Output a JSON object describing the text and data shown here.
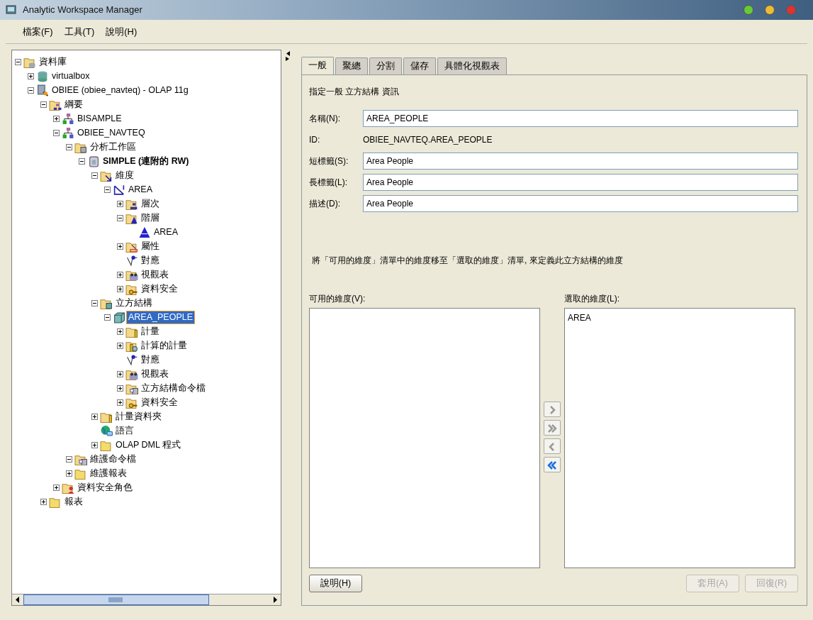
{
  "window": {
    "title": "Analytic Workspace Manager"
  },
  "menu": [
    {
      "label": "檔案(F)"
    },
    {
      "label": "工具(T)"
    },
    {
      "label": "說明(H)"
    }
  ],
  "tree": [
    {
      "label": "資料庫",
      "kind": "db-folder",
      "expanded": true,
      "selected": false,
      "children": [
        {
          "label": "virtualbox",
          "kind": "database",
          "expanded": false,
          "selected": false
        },
        {
          "label": "OBIEE (obiee_navteq) - OLAP 11g",
          "kind": "server",
          "expanded": true,
          "selected": false,
          "children": [
            {
              "label": "綱要",
              "kind": "schema-folder",
              "expanded": true,
              "selected": false,
              "children": [
                {
                  "label": "BISAMPLE",
                  "kind": "schema",
                  "expanded": false,
                  "selected": false
                },
                {
                  "label": "OBIEE_NAVTEQ",
                  "kind": "schema",
                  "expanded": true,
                  "selected": false,
                  "children": [
                    {
                      "label": "分析工作區",
                      "kind": "workspace-folder",
                      "expanded": true,
                      "selected": false,
                      "children": [
                        {
                          "label": "SIMPLE (連附的 RW)",
                          "kind": "workspace",
                          "expanded": true,
                          "selected": false,
                          "children": [
                            {
                              "label": "維度",
                              "kind": "dimension-folder",
                              "expanded": true,
                              "selected": false,
                              "children": [
                                {
                                  "label": "AREA",
                                  "kind": "dimension",
                                  "expanded": true,
                                  "selected": false,
                                  "children": [
                                    {
                                      "label": "層次",
                                      "kind": "level-folder",
                                      "expanded": false,
                                      "selected": false
                                    },
                                    {
                                      "label": "階層",
                                      "kind": "hierarchy-folder",
                                      "expanded": true,
                                      "selected": false,
                                      "children": [
                                        {
                                          "label": "AREA",
                                          "kind": "hierarchy",
                                          "selected": false
                                        }
                                      ]
                                    },
                                    {
                                      "label": "屬性",
                                      "kind": "attribute-folder",
                                      "expanded": false,
                                      "selected": false
                                    },
                                    {
                                      "label": "對應",
                                      "kind": "mapping",
                                      "selected": false
                                    },
                                    {
                                      "label": "視觀表",
                                      "kind": "view-folder",
                                      "expanded": false,
                                      "selected": false
                                    },
                                    {
                                      "label": "資料安全",
                                      "kind": "security-folder",
                                      "expanded": false,
                                      "selected": false
                                    }
                                  ]
                                }
                              ]
                            },
                            {
                              "label": "立方結構",
                              "kind": "cube-folder",
                              "expanded": true,
                              "selected": false,
                              "children": [
                                {
                                  "label": "AREA_PEOPLE",
                                  "kind": "cube",
                                  "expanded": true,
                                  "selected": true,
                                  "children": [
                                    {
                                      "label": "計量",
                                      "kind": "measure-folder",
                                      "expanded": false,
                                      "selected": false
                                    },
                                    {
                                      "label": "計算的計量",
                                      "kind": "calc-folder",
                                      "expanded": false,
                                      "selected": false
                                    },
                                    {
                                      "label": "對應",
                                      "kind": "mapping",
                                      "selected": false
                                    },
                                    {
                                      "label": "視觀表",
                                      "kind": "view-folder",
                                      "expanded": false,
                                      "selected": false
                                    },
                                    {
                                      "label": "立方結構命令檔",
                                      "kind": "script-folder",
                                      "expanded": false,
                                      "selected": false
                                    },
                                    {
                                      "label": "資料安全",
                                      "kind": "security-folder",
                                      "expanded": false,
                                      "selected": false
                                    }
                                  ]
                                }
                              ]
                            },
                            {
                              "label": "計量資料夾",
                              "kind": "measure-folder",
                              "expanded": false,
                              "selected": false
                            },
                            {
                              "label": "語言",
                              "kind": "language",
                              "selected": false
                            },
                            {
                              "label": "OLAP DML 程式",
                              "kind": "folder",
                              "expanded": false,
                              "selected": false
                            }
                          ]
                        }
                      ]
                    },
                    {
                      "label": "維護命令檔",
                      "kind": "script-folder",
                      "expanded": true,
                      "selected": false
                    },
                    {
                      "label": "維護報表",
                      "kind": "folder",
                      "expanded": false,
                      "selected": false
                    }
                  ]
                },
                {
                  "label": "資料安全角色",
                  "kind": "role-folder",
                  "expanded": false,
                  "selected": false
                }
              ]
            },
            {
              "label": "報表",
              "kind": "folder",
              "expanded": false,
              "selected": false
            }
          ]
        }
      ]
    }
  ],
  "tabs": [
    {
      "label": "一般",
      "selected": true
    },
    {
      "label": "聚總",
      "selected": false
    },
    {
      "label": "分割",
      "selected": false
    },
    {
      "label": "儲存",
      "selected": false
    },
    {
      "label": "具體化視觀表",
      "selected": false
    }
  ],
  "form": {
    "heading": "指定一般 立方結構 資訊",
    "fields": [
      {
        "kind": "input",
        "label": "名稱(N):",
        "value": "AREA_PEOPLE"
      },
      {
        "kind": "static",
        "label": "ID:",
        "value": "OBIEE_NAVTEQ.AREA_PEOPLE"
      },
      {
        "kind": "input",
        "label": "短標籤(S):",
        "value": "Area People"
      },
      {
        "kind": "input",
        "label": "長標籤(L):",
        "value": "Area People"
      },
      {
        "kind": "input",
        "label": "描述(D):",
        "value": "Area People"
      }
    ],
    "instruction": "將「可用的維度」清單中的維度移至「選取的維度」清單, 來定義此立方結構的維度",
    "available": {
      "label": "可用的維度(V):"
    },
    "selected_list": {
      "label": "選取的維度(L):",
      "items": [
        "AREA"
      ]
    },
    "move_buttons": [
      {
        "kind": "move-right",
        "disabled": true
      },
      {
        "kind": "move-all-right",
        "disabled": true
      },
      {
        "kind": "move-left",
        "disabled": true
      },
      {
        "kind": "move-all-left",
        "disabled": false
      }
    ]
  },
  "help_button": {
    "label": "說明(H)",
    "disabled": false
  },
  "action_buttons": [
    {
      "label": "套用(A)",
      "disabled": true
    },
    {
      "label": "回復(R)",
      "disabled": true
    }
  ]
}
